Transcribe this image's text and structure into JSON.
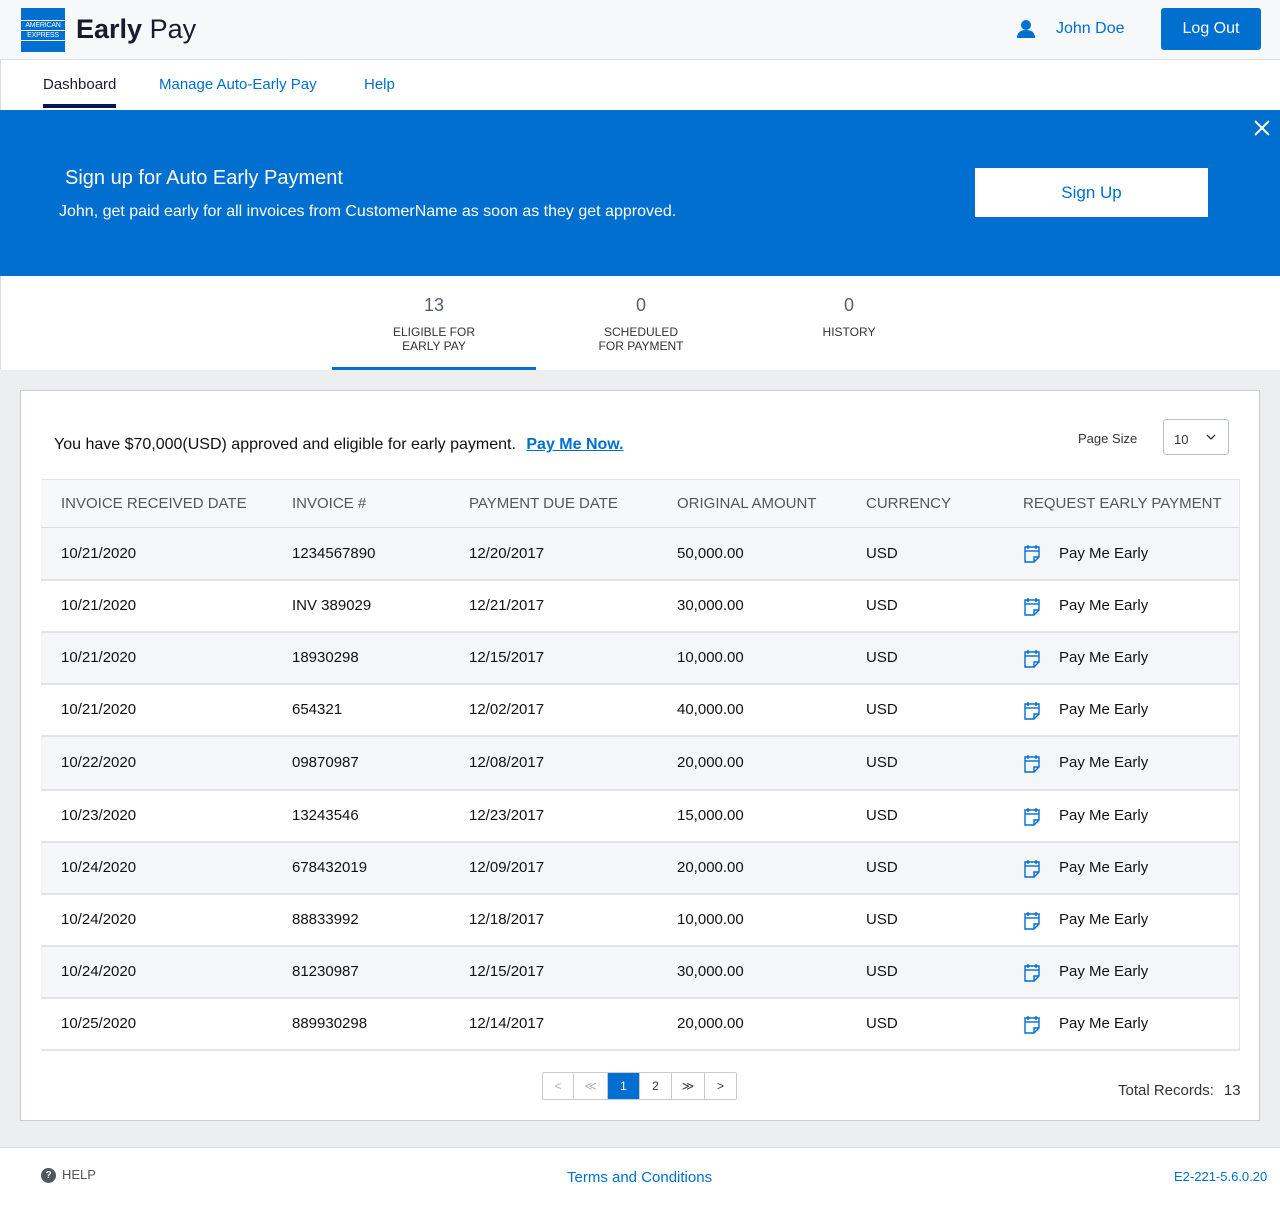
{
  "header": {
    "logo_line1": "AMERICAN",
    "logo_line2": "EXPRESS",
    "title_bold": "Early",
    "title_rest": "Pay",
    "user_name": "John Doe",
    "logout_label": "Log Out"
  },
  "nav": {
    "items": [
      {
        "label": "Dashboard"
      },
      {
        "label": "Manage Auto-Early Pay"
      },
      {
        "label": "Help"
      }
    ]
  },
  "banner": {
    "title": "Sign up for Auto Early Payment",
    "text": "John, get paid early for all invoices from CustomerName as soon as they get approved.",
    "signup_label": "Sign Up"
  },
  "stats": [
    {
      "count": "13",
      "label_line1": "ELIGIBLE FOR",
      "label_line2": "EARLY PAY"
    },
    {
      "count": "0",
      "label_line1": "SCHEDULED",
      "label_line2": "FOR PAYMENT"
    },
    {
      "count": "0",
      "label_line1": "HISTORY",
      "label_line2": ""
    }
  ],
  "summary": {
    "text": "You have $70,000(USD) approved and eligible for early payment.",
    "pay_now_label": "Pay Me Now.",
    "page_size_label": "Page Size",
    "page_size_value": "10"
  },
  "table": {
    "headers": [
      "INVOICE RECEIVED DATE",
      "INVOICE #",
      "PAYMENT DUE DATE",
      "ORIGINAL AMOUNT",
      "CURRENCY",
      "REQUEST EARLY PAYMENT"
    ],
    "action_label": "Pay Me Early",
    "rows": [
      {
        "received": "10/21/2020",
        "invoice": "1234567890",
        "due": "12/20/2017",
        "amount": "50,000.00",
        "currency": "USD"
      },
      {
        "received": "10/21/2020",
        "invoice": "INV 389029",
        "due": "12/21/2017",
        "amount": "30,000.00",
        "currency": "USD"
      },
      {
        "received": "10/21/2020",
        "invoice": "18930298",
        "due": "12/15/2017",
        "amount": "10,000.00",
        "currency": "USD"
      },
      {
        "received": "10/21/2020",
        "invoice": "654321",
        "due": "12/02/2017",
        "amount": "40,000.00",
        "currency": "USD"
      },
      {
        "received": "10/22/2020",
        "invoice": "09870987",
        "due": "12/08/2017",
        "amount": "20,000.00",
        "currency": "USD"
      },
      {
        "received": "10/23/2020",
        "invoice": "13243546",
        "due": "12/23/2017",
        "amount": "15,000.00",
        "currency": "USD"
      },
      {
        "received": "10/24/2020",
        "invoice": "678432019",
        "due": "12/09/2017",
        "amount": "20,000.00",
        "currency": "USD"
      },
      {
        "received": "10/24/2020",
        "invoice": "88833992",
        "due": "12/18/2017",
        "amount": "10,000.00",
        "currency": "USD"
      },
      {
        "received": "10/24/2020",
        "invoice": "81230987",
        "due": "12/15/2017",
        "amount": "30,000.00",
        "currency": "USD"
      },
      {
        "received": "10/25/2020",
        "invoice": "889930298",
        "due": "12/14/2017",
        "amount": "20,000.00",
        "currency": "USD"
      }
    ]
  },
  "pagination": {
    "prev": "<",
    "first": "≪",
    "pages": [
      "1",
      "2"
    ],
    "current": "1",
    "last": "≫",
    "next": ">",
    "total_label": "Total Records:",
    "total_value": "13"
  },
  "footer": {
    "help_icon_glyph": "?",
    "help_label": "HELP",
    "terms_label": "Terms and Conditions",
    "version": "E2-221-5.6.0.20"
  },
  "colors": {
    "brand_blue": "#006fcf",
    "navy": "#00175a",
    "banner_blue": "#006fcf"
  },
  "icons": {
    "user": "user-icon",
    "close": "close-icon",
    "calendar": "calendar-icon",
    "chevron": "chevron-down-icon",
    "help": "help-icon"
  }
}
